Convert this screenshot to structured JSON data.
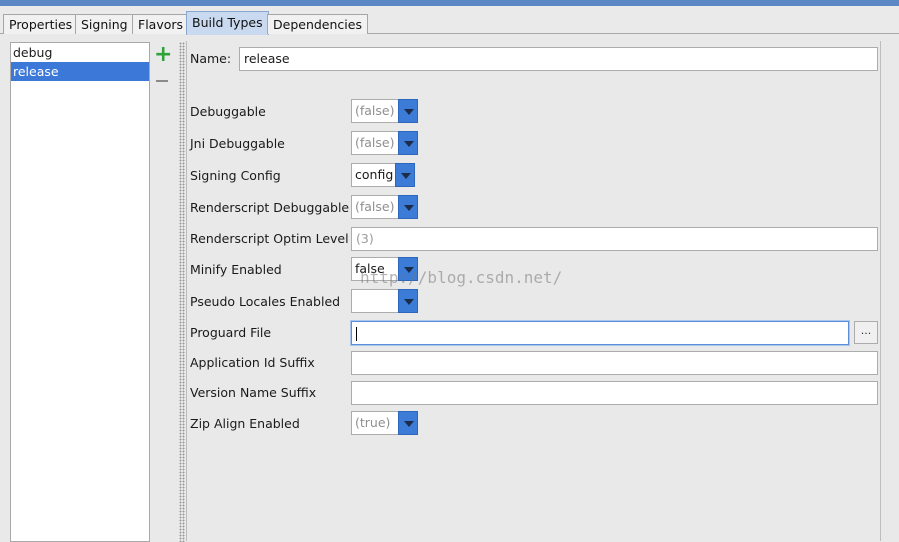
{
  "tabs": [
    {
      "label": "Properties"
    },
    {
      "label": "Signing"
    },
    {
      "label": "Flavors"
    },
    {
      "label": "Build Types",
      "active": true
    },
    {
      "label": "Dependencies"
    }
  ],
  "build_types": [
    {
      "label": "debug"
    },
    {
      "label": "release",
      "selected": true
    }
  ],
  "icons": {
    "add": "plus-icon",
    "remove": "minus-icon",
    "add_color": "#2ea33a",
    "accent": "#3b78d8"
  },
  "form": {
    "name_label": "Name:",
    "name_value": "release",
    "debuggable_label": "Debuggable",
    "debuggable_value": "(false)",
    "jni_label": "Jni Debuggable",
    "jni_value": "(false)",
    "signing_label": "Signing Config",
    "signing_value": "config",
    "rs_debug_label": "Renderscript Debuggable",
    "rs_debug_value": "(false)",
    "rs_optim_label": "Renderscript Optim Level",
    "rs_optim_value": "(3)",
    "minify_label": "Minify Enabled",
    "minify_value": "false",
    "pseudo_label": "Pseudo Locales Enabled",
    "pseudo_value": "",
    "proguard_label": "Proguard File",
    "proguard_value": "",
    "browse_label": "...",
    "appid_label": "Application Id Suffix",
    "appid_value": "",
    "version_label": "Version Name Suffix",
    "version_value": "",
    "zip_label": "Zip Align Enabled",
    "zip_value": "(true)"
  },
  "watermark": "http://blog.csdn.net/"
}
